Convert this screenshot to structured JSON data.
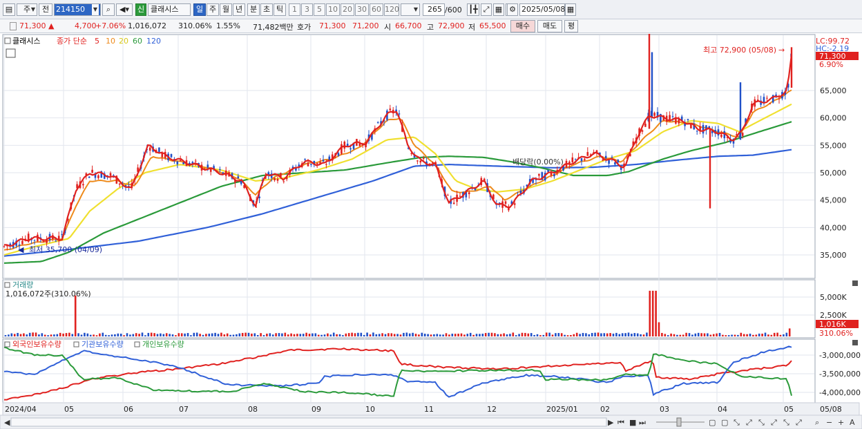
{
  "toolbar": {
    "market": "주",
    "prefix": "전",
    "code": "214150",
    "badge": "신",
    "name": "클래시스",
    "periods": [
      "일",
      "주",
      "월",
      "년",
      "분",
      "초",
      "틱"
    ],
    "period_selected": "일",
    "ticks": [
      "1",
      "3",
      "5",
      "10",
      "20",
      "30",
      "60",
      "120"
    ],
    "count": "265",
    "count_total": "/600",
    "date": "2025/05/08"
  },
  "quote": {
    "price": "71,300",
    "change": "4,700",
    "change_pct": "+7.06%",
    "volume": "1,016,072",
    "volume_pct": "310.06%",
    "turnover_pct": "1.55%",
    "amount": "71,482백만",
    "hoga_label": "호가",
    "ask": "71,300",
    "bid": "71,200",
    "open_label": "시",
    "open": "66,700",
    "high_label": "고",
    "high": "72,900",
    "low_label": "저",
    "low": "65,500",
    "buy_label": "매수",
    "sell_label": "매도",
    "eval_label": "평"
  },
  "legend": {
    "name": "클래시스",
    "ma_label": "종가 단순",
    "ma_periods": [
      "5",
      "10",
      "20",
      "60",
      "120"
    ],
    "ma_colors": [
      "#e0211f",
      "#ee8a1a",
      "#e8d82a",
      "#2a9a3a",
      "#3060d8"
    ],
    "lc": "LC:99.72",
    "hc": "HC:-2.19",
    "price_tag": "71,300",
    "pct_tag": "6.90%",
    "high_note": "최고 72,900 (05/08)",
    "low_note": "최저 35,700 (04/09)",
    "dividend_note": "배당락(0.00%)"
  },
  "volume_pane": {
    "title": "거래량",
    "value": "1,016,072주(310.06%)",
    "tag": "1,016K",
    "tag_pct": "310.06%",
    "axis": [
      "5,000K",
      "2,500K"
    ]
  },
  "holdings_pane": {
    "series": [
      "외국인보유수량",
      "기관보유수량",
      "개인보유수량"
    ],
    "colors": [
      "#e0211f",
      "#3060d8",
      "#2a9a3a"
    ],
    "axis": [
      "-3,000,000",
      "-3,500,000",
      "-4,000,000"
    ]
  },
  "price_axis": [
    "65,000",
    "60,000",
    "55,000",
    "50,000",
    "45,000",
    "40,000",
    "35,000"
  ],
  "x_axis": [
    "2024/04",
    "05",
    "06",
    "07",
    "08",
    "09",
    "10",
    "11",
    "12",
    "2025/01",
    "02",
    "03",
    "04",
    "05"
  ],
  "x_axis_end": "05/08"
}
